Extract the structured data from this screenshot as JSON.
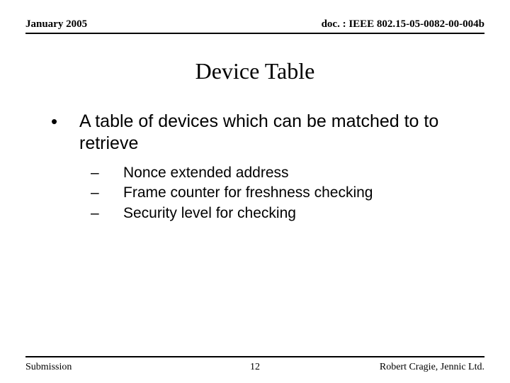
{
  "header": {
    "date": "January 2005",
    "docref": "doc. : IEEE 802.15-05-0082-00-004b"
  },
  "title": "Device Table",
  "content": {
    "bullet_marker": "•",
    "main_bullet": "A table of devices which can be matched to to retrieve",
    "sub_marker": "–",
    "subs": {
      "0": "Nonce extended address",
      "1": "Frame counter for freshness checking",
      "2": "Security level for checking"
    }
  },
  "footer": {
    "left": "Submission",
    "center": "12",
    "right": "Robert Cragie, Jennic Ltd."
  }
}
